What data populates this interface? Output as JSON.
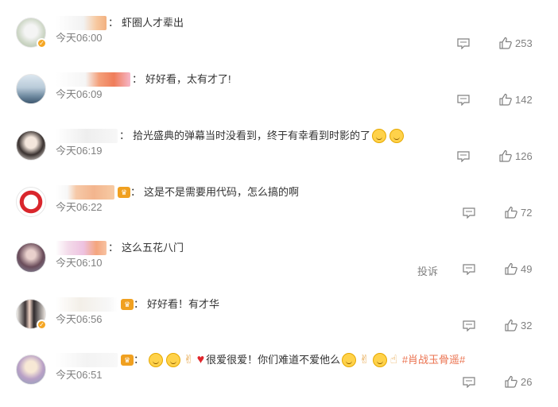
{
  "comments": [
    {
      "text": "虾圈人才辈出",
      "time": "今天06:00",
      "likes": "253"
    },
    {
      "text": "好好看，太有才了!",
      "time": "今天06:09",
      "likes": "142"
    },
    {
      "text": "拾光盛典的弹幕当时没看到，终于有幸看到时影的了",
      "time": "今天06:19",
      "likes": "126"
    },
    {
      "text": "这是不是需要用代码，怎么搞的啊",
      "time": "今天06:22",
      "likes": "72"
    },
    {
      "text": "这么五花八门",
      "time": "今天06:10",
      "likes": "49",
      "report": "投诉"
    },
    {
      "text": "好好看！有才华",
      "time": "今天06:56",
      "likes": "32"
    },
    {
      "text": "很爱很爱！你们难道不爱他么",
      "hashtag": "#肖战玉骨遥#",
      "time": "今天06:51",
      "likes": "26"
    }
  ],
  "colors": {
    "hashtag": "#eb7350",
    "time": "#808080",
    "verified": "#f5a623"
  },
  "icons": {
    "reply": "comment-icon",
    "like": "thumbs-up-icon",
    "verified": "verified-badge-icon"
  }
}
